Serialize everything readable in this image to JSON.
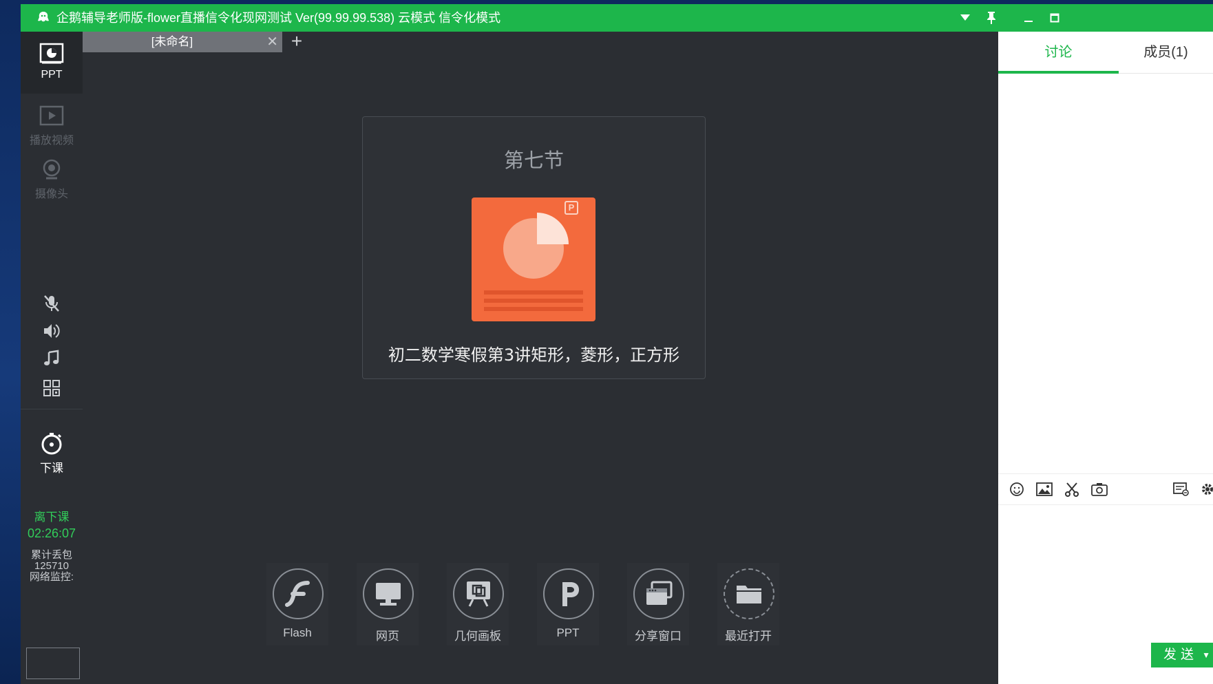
{
  "window": {
    "title": "企鹅辅导老师版-flower直播信令化现网测试 Ver(99.99.99.538) 云模式 信令化模式"
  },
  "nav": {
    "ppt": "PPT",
    "video": "播放视频",
    "camera": "摄像头",
    "end_class": "下课"
  },
  "status": {
    "leave_label": "离下课",
    "timer": "02:26:07",
    "packet_loss_label": "累计丢包",
    "packet_loss_value": "125710",
    "network_label": "网络监控:"
  },
  "tabs": [
    {
      "label": "[未命名]"
    }
  ],
  "document": {
    "title": "第七节",
    "badge": "P",
    "name": "初二数学寒假第3讲矩形，菱形，正方形"
  },
  "tools": [
    {
      "label": "Flash",
      "icon": "flash-icon"
    },
    {
      "label": "网页",
      "icon": "monitor-icon"
    },
    {
      "label": "几何画板",
      "icon": "geometry-board-icon"
    },
    {
      "label": "PPT",
      "icon": "ppt-icon"
    },
    {
      "label": "分享窗口",
      "icon": "share-window-icon"
    },
    {
      "label": "最近打开",
      "icon": "folder-icon"
    }
  ],
  "chat": {
    "tab_discuss": "讨论",
    "tab_members": "成员(1)",
    "send_label": "发送"
  },
  "colors": {
    "accent": "#1db64b",
    "ppt_orange": "#f36a3d",
    "bg_dark": "#2b2e33"
  }
}
